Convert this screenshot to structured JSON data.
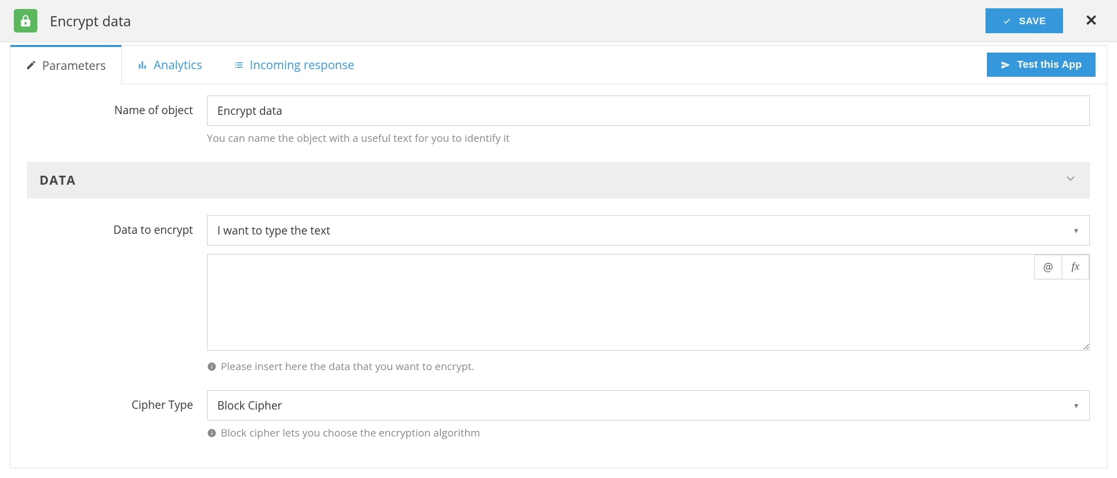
{
  "header": {
    "title": "Encrypt data",
    "save_label": "SAVE"
  },
  "tabs": {
    "parameters": "Parameters",
    "analytics": "Analytics",
    "incoming": "Incoming response",
    "test_label": "Test this App"
  },
  "form": {
    "name_label": "Name of object",
    "name_value": "Encrypt data",
    "name_help": "You can name the object with a useful text for you to identify it"
  },
  "section": {
    "data_title": "DATA"
  },
  "data_to_encrypt": {
    "label": "Data to encrypt",
    "select_value": "I want to type the text",
    "textarea_value": "",
    "help": "Please insert here the data that you want to encrypt.",
    "at_label": "@",
    "fx_label": "fx"
  },
  "cipher": {
    "label": "Cipher Type",
    "select_value": "Block Cipher",
    "help": "Block cipher lets you choose the encryption algorithm"
  }
}
